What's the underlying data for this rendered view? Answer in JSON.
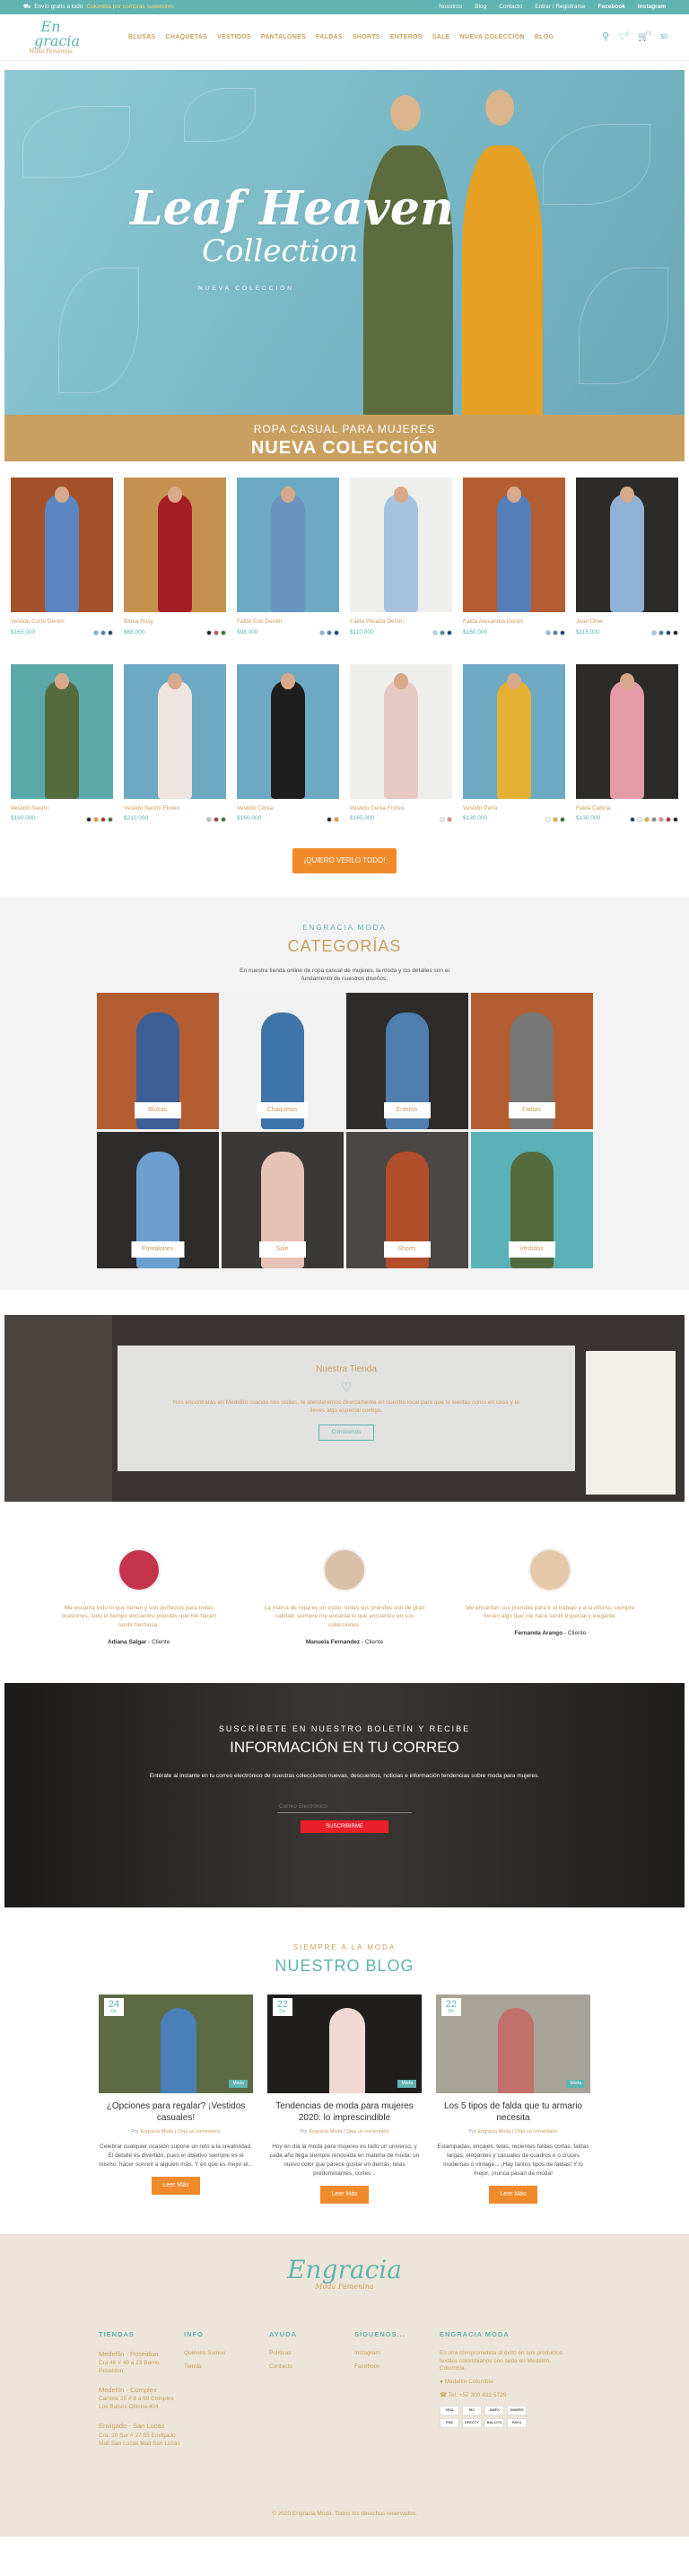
{
  "topbar": {
    "promo_icon": "truck-icon",
    "promo_a": "Envío gratis a todo",
    "promo_b": "Colombia por compras superiores",
    "links": [
      "Nosotros",
      "Blog",
      "Contacto",
      "Entrar / Registrarse"
    ],
    "social": [
      "Facebook",
      "Instagram"
    ]
  },
  "logo": {
    "line1": "En",
    "line2": "gracia",
    "line3": "Moda Femenina"
  },
  "nav": [
    "BLUSAS",
    "CHAQUETAS",
    "VESTIDOS",
    "PANTALONES",
    "FALDAS",
    "SHORTS",
    "ENTEROS",
    "SALE",
    "NUEVA COLECCIÓN",
    "BLOG"
  ],
  "header": {
    "wishlist_count": "0",
    "cart_count": "0",
    "cart_total": "$0"
  },
  "hero": {
    "title1": "Leaf Heaven",
    "title2": "Collection",
    "subtitle": "NUEVA COLECCIÓN"
  },
  "banner": {
    "line1": "ROPA CASUAL PARA MUJERES",
    "line2": "NUEVA COLECCIÓN"
  },
  "products_row1": [
    {
      "name": "Vestido Corto Denim",
      "price": "$165.000",
      "bg": "#a5512b",
      "fig": "#5b86c1",
      "colors": [
        "#6fb3d2",
        "#3f7db8",
        "#1f3d6e"
      ]
    },
    {
      "name": "Blusa Rosy",
      "price": "$68.000",
      "bg": "#c5914e",
      "fig": "#a31f25",
      "colors": [
        "#222",
        "#c34747",
        "#3e6b3b"
      ]
    },
    {
      "name": "Falda Eno Denim",
      "price": "$98.000",
      "bg": "#6ea9c4",
      "fig": "#6a93bf",
      "colors": [
        "#8ab7d8",
        "#3f7db8",
        "#1f3d6e"
      ]
    },
    {
      "name": "Falda Plisada Denim",
      "price": "$110.000",
      "bg": "#eeeeec",
      "fig": "#a6c2de",
      "colors": [
        "#b5d2ea",
        "#3f7db8",
        "#1f3d6e"
      ]
    },
    {
      "name": "Falda Alexandra Denim",
      "price": "$160.000",
      "bg": "#b25e32",
      "fig": "#557fb8",
      "colors": [
        "#8ab7d8",
        "#3f7db8",
        "#1f3d6e"
      ]
    },
    {
      "name": "Jean Oner",
      "price": "$115.000",
      "bg": "#2d2b2a",
      "fig": "#8fb1d3",
      "colors": [
        "#a3c7e3",
        "#3f7db8",
        "#1f3d6e",
        "#222"
      ]
    }
  ],
  "products_row2": [
    {
      "name": "Vestido Naomi",
      "price": "$190.000",
      "bg": "#5aa8aa",
      "fig": "#546b3d",
      "colors": [
        "#222",
        "#e89a2f",
        "#a33",
        "#4b6a3a"
      ]
    },
    {
      "name": "Vestido Naomi Floreo",
      "price": "$210.000",
      "bg": "#6ea9c4",
      "fig": "#efe4e0",
      "colors": [
        "#bbb",
        "#a33",
        "#3e6b3b"
      ]
    },
    {
      "name": "Vestido Cenia",
      "price": "$160.000",
      "bg": "#6ea9c4",
      "fig": "#1e1e1e",
      "colors": [
        "#222",
        "#e89a2f"
      ]
    },
    {
      "name": "Vestido Cenia Floreo",
      "price": "$165.000",
      "bg": "#eeeeec",
      "fig": "#e6c9c2",
      "colors": [
        "#eee",
        "#d88"
      ]
    },
    {
      "name": "Vestido Perla",
      "price": "$130.000",
      "bg": "#6ea9c4",
      "fig": "#e3b033",
      "colors": [
        "#fff",
        "#e3b033",
        "#3e6b3b"
      ]
    },
    {
      "name": "Falda Cabiria",
      "price": "$130.000",
      "bg": "#2d2b2a",
      "fig": "#e59aa7",
      "colors": [
        "#1f3d6e",
        "#eee",
        "#e3b033",
        "#888",
        "#d88",
        "#a33",
        "#222"
      ]
    }
  ],
  "cta": "¡QUIERO VERLO TODO!",
  "categories": {
    "kicker": "ENGRACIA MODA",
    "title": "CATEGORÍAS",
    "desc": "En nuestra tienda online de ropa casual de mujeres, la moda y los detalles son el fundamento de nuestros diseños.",
    "items": [
      {
        "label": "Blusas",
        "bg": "#b25e32",
        "fig": "#3d5f97"
      },
      {
        "label": "Chaquetas",
        "bg": "#f1f1f1",
        "fig": "#3f74a9"
      },
      {
        "label": "Enteros",
        "bg": "#2e2c2b",
        "fig": "#4f7fae"
      },
      {
        "label": "Faldas",
        "bg": "#b25e32",
        "fig": "#777"
      },
      {
        "label": "Pantalones",
        "bg": "#2e2c2b",
        "fig": "#6c9ed0"
      },
      {
        "label": "Sale",
        "bg": "#3b3936",
        "fig": "#e6c1b5"
      },
      {
        "label": "Shorts",
        "bg": "#4a4744",
        "fig": "#b34e2a"
      },
      {
        "label": "Vestidos",
        "bg": "#5ab2b8",
        "fig": "#546b3d"
      }
    ]
  },
  "store": {
    "title": "Nuestra Tienda",
    "icon": "heart-icon",
    "text": "Nos encontrarás en Medellín cuando nos visites, te atenderemos directamente en nuestro local para que te sientas como en casa y te lleves algo especial contigo.",
    "button": "Conócenos"
  },
  "testimonials": [
    {
      "text": "Me encanta todo lo que tienen y son perfectos para todas ocasiones, todo el tiempo encuentro prendas que me hacen sentir hermosa.",
      "name": "Adiana Salgar",
      "role": "Cliente",
      "bg": "#c4344c"
    },
    {
      "text": "La marca de ropa es un estilo, todas sus prendas son de gran calidad, siempre me encanta lo que encuentro en sus colecciones.",
      "name": "Manuela Fernandez",
      "role": "Cliente",
      "bg": "#d9c0a7"
    },
    {
      "text": "Me encantan sus prendas para ir al trabajo y a la oficina, siempre tienen algo que me hace sentir especial y elegante.",
      "name": "Fernanda Arango",
      "role": "Cliente",
      "bg": "#e5c7a9"
    }
  ],
  "newsletter": {
    "kicker": "SUSCRÍBETE EN NUESTRO BOLETÍN Y RECIBE",
    "title": "INFORMACIÓN EN TU CORREO",
    "text": "Entérate al instante en tu correo electrónico de nuestras colecciones nuevas, descuentos, noticias e información tendencias sobre moda para mujeres.",
    "placeholder": "Correo Electrónico",
    "button": "SUSCRIBIRME"
  },
  "blog": {
    "kicker": "SIEMPRE A LA MODA",
    "title": "NUESTRO BLOG",
    "posts": [
      {
        "day": "24",
        "month": "Dic",
        "tag": "Moda",
        "title": "¿Opciones para regalar? ¡Vestidos casuales!",
        "author": "Engracia Moda",
        "comments": "Deja un comentario",
        "text": "Celebrar cualquier ocasión supone un reto a la creatividad. El detalle es divertido, pues el objetivo siempre es el mismo: hacer sonreír a alguien más. Y en que es mejor el...",
        "button": "Leer Más",
        "bg": "#5e6a44",
        "fig": "#4a7fb8"
      },
      {
        "day": "22",
        "month": "Dic",
        "tag": "Moda",
        "title": "Tendencias de moda para mujeres 2020: lo imprescindible",
        "author": "Engracia Moda",
        "comments": "Deja un comentario",
        "text": "Hoy en día la moda para mujeres es todo un universo, y cada año llega siempre renovada en materia de moda: un nuevo color que parece gustar en demás, telas predominantes, cortes...",
        "button": "Leer Más",
        "bg": "#1f1e1d",
        "fig": "#f2d8d3"
      },
      {
        "day": "22",
        "month": "Dic",
        "tag": "Moda",
        "title": "Los 5 tipos de falda que tu armario necesita",
        "author": "Engracia Moda",
        "comments": "Deja un comentario",
        "text": "Estampadas, encajes, telas, recientes faldas cortas, faldas largas, elegantes y casuales de cuadros e o cruces modernas o vintage... ¡Hay tantos tipos de faldas! Y lo mejor, ¡nunca pasan de moda!",
        "button": "Leer Más",
        "bg": "#a7a497",
        "fig": "#c36f6c"
      }
    ]
  },
  "footer": {
    "logo1": "Engracia",
    "logo3": "Moda Femenina",
    "tiendas_title": "TIENDAS",
    "tiendas": [
      {
        "name": "Medellín - Poseidon",
        "addr": "Cra 46 # 49 a 23 Barrio Poseidon"
      },
      {
        "name": "Medellín - Complex",
        "addr": "Carrera 25 # 8 a 99 Complex Los Balsos Oficina 404"
      },
      {
        "name": "Envigado - San Lucas",
        "addr": "Cra. 20 Sur # 27 55 Envigado Mall San Lucas Mall San Lucas"
      }
    ],
    "info_title": "INFO",
    "info": [
      "Quiénes Somos",
      "Tienda"
    ],
    "ayuda_title": "AYUDA",
    "ayuda": [
      "Políticas",
      "Contacto"
    ],
    "sig_title": "SÍGUENOS...",
    "sig": [
      "Instagram",
      "Facebook"
    ],
    "eng_title": "ENGRACIA MODA",
    "eng_text": "Es una comprometida al éxito en sus productos textiles colombianos con sede en Medellín, Colombia.",
    "eng_loc": "Medellín Colombia",
    "eng_tel": "Tel: +57 300 492 5729",
    "payments": [
      "VISA",
      "MC",
      "AMEX",
      "DINERS",
      "PSE",
      "EFECTY",
      "BALOTO",
      "PAYU"
    ]
  },
  "copyright": "© 2020 Engracia Moda. Todos los derechos reservados."
}
